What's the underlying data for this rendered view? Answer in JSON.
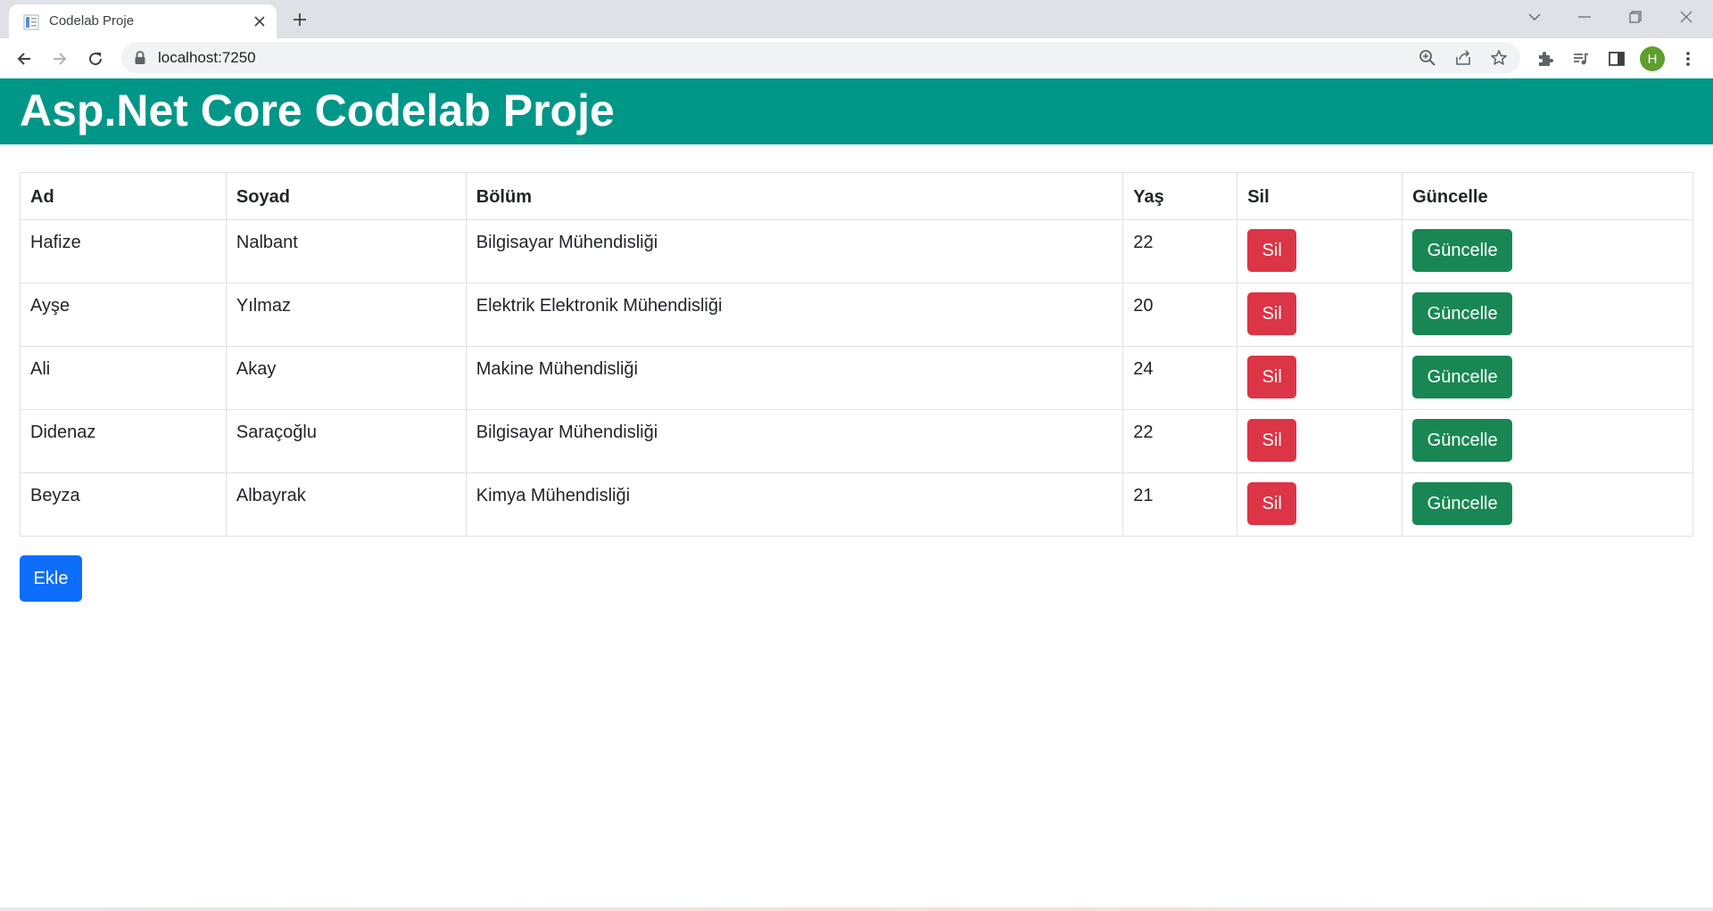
{
  "browser": {
    "tab_title": "Codelab Proje",
    "url": "localhost:7250",
    "profile_initial": "H"
  },
  "page": {
    "header_title": "Asp.Net Core Codelab Proje",
    "accent_color": "#009688",
    "table": {
      "headers": {
        "ad": "Ad",
        "soyad": "Soyad",
        "bolum": "Bölüm",
        "yas": "Yaş",
        "sil": "Sil",
        "guncelle": "Güncelle"
      },
      "rows": [
        {
          "ad": "Hafize",
          "soyad": "Nalbant",
          "bolum": "Bilgisayar Mühendisliği",
          "yas": "22",
          "sil_label": "Sil",
          "guncelle_label": "Güncelle"
        },
        {
          "ad": "Ayşe",
          "soyad": "Yılmaz",
          "bolum": "Elektrik Elektronik Mühendisliği",
          "yas": "20",
          "sil_label": "Sil",
          "guncelle_label": "Güncelle"
        },
        {
          "ad": "Ali",
          "soyad": "Akay",
          "bolum": "Makine Mühendisliği",
          "yas": "24",
          "sil_label": "Sil",
          "guncelle_label": "Güncelle"
        },
        {
          "ad": "Didenaz",
          "soyad": "Saraçoğlu",
          "bolum": "Bilgisayar Mühendisliği",
          "yas": "22",
          "sil_label": "Sil",
          "guncelle_label": "Güncelle"
        },
        {
          "ad": "Beyza",
          "soyad": "Albayrak",
          "bolum": "Kimya Mühendisliği",
          "yas": "21",
          "sil_label": "Sil",
          "guncelle_label": "Güncelle"
        }
      ]
    },
    "add_label": "Ekle",
    "colors": {
      "danger": "#dc3545",
      "success": "#198754",
      "primary": "#0d6efd"
    }
  }
}
